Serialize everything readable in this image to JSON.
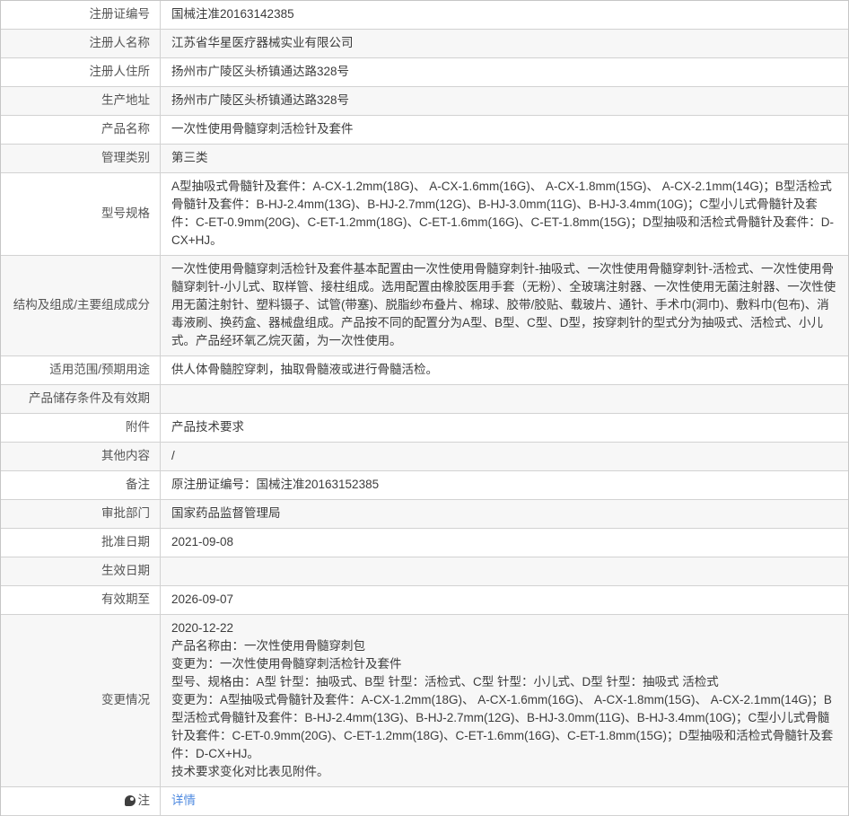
{
  "colors": {
    "link_blue": "#4f8ae0",
    "row_shade": "#f7f7f7",
    "border": "#d2d2d2",
    "label_text": "#555555",
    "value_text": "#3c3c3c"
  },
  "rows": [
    {
      "label": "注册证编号",
      "value": "国械注准20163142385"
    },
    {
      "label": "注册人名称",
      "value": "江苏省华星医疗器械实业有限公司"
    },
    {
      "label": "注册人住所",
      "value": "扬州市广陵区头桥镇通达路328号"
    },
    {
      "label": "生产地址",
      "value": "扬州市广陵区头桥镇通达路328号"
    },
    {
      "label": "产品名称",
      "value": "一次性使用骨髓穿刺活检针及套件"
    },
    {
      "label": "管理类别",
      "value": "第三类"
    },
    {
      "label": "型号规格",
      "value": "A型抽吸式骨髓针及套件：A-CX-1.2mm(18G)、 A-CX-1.6mm(16G)、 A-CX-1.8mm(15G)、 A-CX-2.1mm(14G)；B型活检式骨髓针及套件：B-HJ-2.4mm(13G)、B-HJ-2.7mm(12G)、B-HJ-3.0mm(11G)、B-HJ-3.4mm(10G)；C型小儿式骨髓针及套件：C-ET-0.9mm(20G)、C-ET-1.2mm(18G)、C-ET-1.6mm(16G)、C-ET-1.8mm(15G)；D型抽吸和活检式骨髓针及套件：D-CX+HJ。"
    },
    {
      "label": "结构及组成/主要组成成分",
      "value": "一次性使用骨髓穿刺活检针及套件基本配置由一次性使用骨髓穿刺针-抽吸式、一次性使用骨髓穿刺针-活检式、一次性使用骨髓穿刺针-小儿式、取样管、接柱组成。选用配置由橡胶医用手套（无粉）、全玻璃注射器、一次性使用无菌注射器、一次性使用无菌注射针、塑料镊子、试管(带塞)、脱脂纱布叠片、棉球、胶带/胶贴、载玻片、通针、手术巾(洞巾)、敷料巾(包布)、消毒液刷、换药盒、器械盘组成。产品按不同的配置分为A型、B型、C型、D型，按穿刺针的型式分为抽吸式、活检式、小儿式。产品经环氧乙烷灭菌，为一次性使用。"
    },
    {
      "label": "适用范围/预期用途",
      "value": "供人体骨髓腔穿刺，抽取骨髓液或进行骨髓活检。"
    },
    {
      "label": "产品储存条件及有效期",
      "value": ""
    },
    {
      "label": "附件",
      "value": "产品技术要求"
    },
    {
      "label": "其他内容",
      "value": "/"
    },
    {
      "label": "备注",
      "value": "原注册证编号：国械注准20163152385"
    },
    {
      "label": "审批部门",
      "value": "国家药品监督管理局"
    },
    {
      "label": "批准日期",
      "value": "2021-09-08"
    },
    {
      "label": "生效日期",
      "value": ""
    },
    {
      "label": "有效期至",
      "value": "2026-09-07"
    },
    {
      "label": "变更情况",
      "lines": [
        "2020-12-22",
        "产品名称由：一次性使用骨髓穿刺包",
        "变更为：一次性使用骨髓穿刺活检针及套件",
        "型号、规格由：A型 针型：抽吸式、B型 针型：活检式、C型 针型：小儿式、D型 针型：抽吸式 活检式",
        "变更为：A型抽吸式骨髓针及套件：A-CX-1.2mm(18G)、 A-CX-1.6mm(16G)、 A-CX-1.8mm(15G)、 A-CX-2.1mm(14G)；B型活检式骨髓针及套件：B-HJ-2.4mm(13G)、B-HJ-2.7mm(12G)、B-HJ-3.0mm(11G)、B-HJ-3.4mm(10G)；C型小儿式骨髓针及套件：C-ET-0.9mm(20G)、C-ET-1.2mm(18G)、C-ET-1.6mm(16G)、C-ET-1.8mm(15G)；D型抽吸和活检式骨髓针及套件：D-CX+HJ。",
        "技术要求变化对比表见附件。"
      ]
    },
    {
      "label": "注",
      "icon": "note-balloon-icon",
      "link_label": "详情"
    }
  ]
}
